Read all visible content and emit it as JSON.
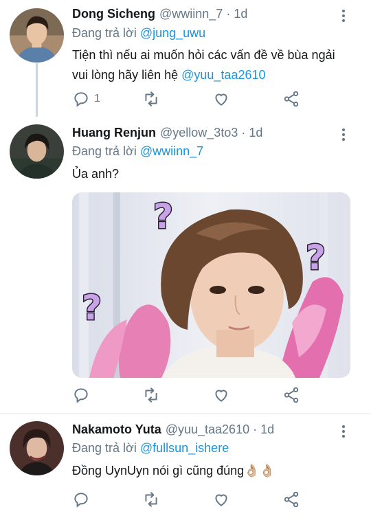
{
  "tweets": [
    {
      "name": "Dong  Sicheng",
      "handle": "@wwiinn_7",
      "separator": "·",
      "time": "1d",
      "reply_prefix": "Đang trả lời",
      "reply_to": "@jung_uwu",
      "text_line1": "Tiện thì nếu ai muốn hỏi các vấn đề về bùa ngải",
      "text_line2_prefix": "vui lòng hãy liên hệ",
      "text_line2_mention": "@yuu_taa2610",
      "reply_count": "1"
    },
    {
      "name": "Huang Renjun",
      "handle": "@yellow_3to3",
      "separator": "·",
      "time": "1d",
      "reply_prefix": "Đang trả lời",
      "reply_to": "@wwiinn_7",
      "text": "Ủa anh?",
      "media_marks": [
        "?",
        "?",
        "?"
      ]
    },
    {
      "name": "Nakamoto Yuta",
      "handle": "@yuu_taa2610",
      "separator": "·",
      "time": "1d",
      "reply_prefix": "Đang trả lời",
      "reply_to": "@fullsun_ishere",
      "text": "Đồng UynUyn nói gì cũng đúng",
      "emoji": "👌🏼👌🏼"
    }
  ],
  "icons": {
    "reply": "reply-icon",
    "retweet": "retweet-icon",
    "like": "heart-icon",
    "share": "share-icon",
    "more": "more-vertical-icon"
  },
  "colors": {
    "link": "#1b95e0",
    "secondary": "#657786",
    "divider": "#e6ecf0",
    "thread_line": "#ccd6dd"
  }
}
